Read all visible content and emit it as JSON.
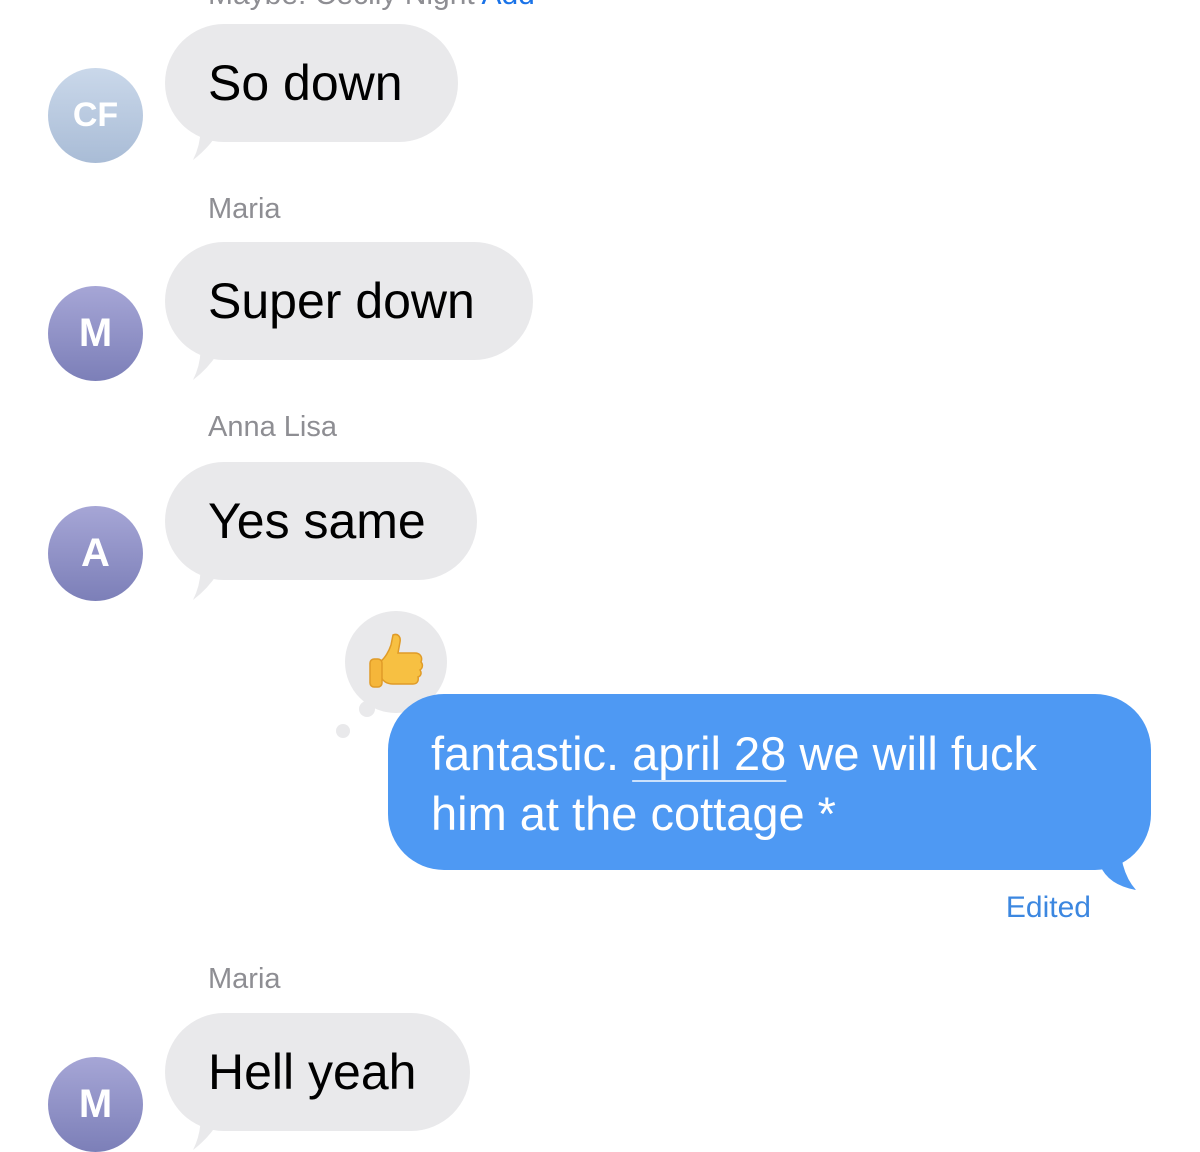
{
  "header": {
    "clipped_text": "Maybe: Cecily Night",
    "clipped_link": "Add"
  },
  "messages": [
    {
      "sender": "",
      "avatar_initials": "CF",
      "text": "So down"
    },
    {
      "sender": "Maria",
      "avatar_initials": "M",
      "text": "Super down"
    },
    {
      "sender": "Anna Lisa",
      "avatar_initials": "A",
      "text": "Yes same"
    },
    {
      "sender": "",
      "outgoing": true,
      "tapback_icon": "thumbs-up-icon",
      "text_before": "fantastic. ",
      "date_link": "april 28",
      "text_after": " we will fuck him at the cottage *",
      "edited_label": "Edited"
    },
    {
      "sender": "Maria",
      "avatar_initials": "M",
      "text": "Hell yeah"
    }
  ],
  "colors": {
    "incoming_bubble": "#e9e9eb",
    "outgoing_bubble": "#4e99f3",
    "edited_label": "#3c87e0",
    "sender_name": "#8e8e93"
  }
}
